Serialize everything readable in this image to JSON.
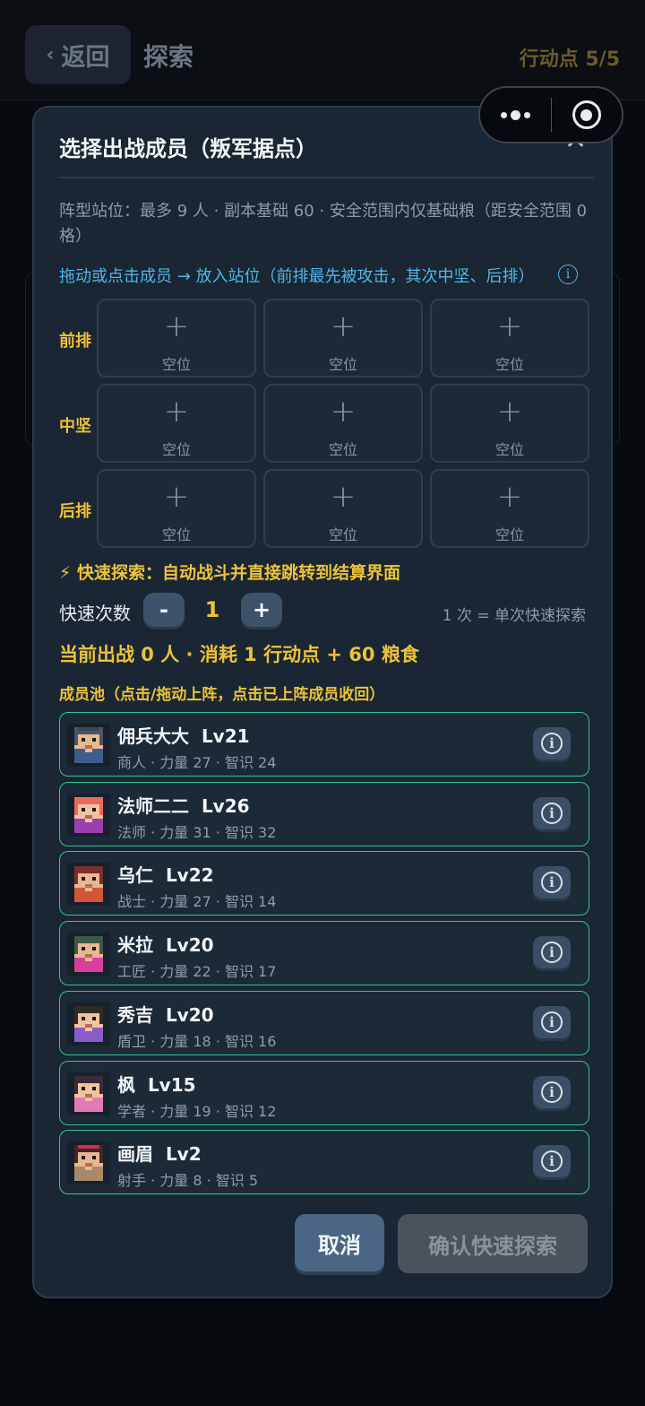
{
  "background": {
    "back_label": "返回",
    "page_title": "探索",
    "action_points": "行动点 5/5"
  },
  "modal": {
    "title": "选择出战成员（叛军据点）",
    "description": "阵型站位：最多 9 人 · 副本基础 60 · 安全范围内仅基础粮（距安全范围 0 格）",
    "hint": "拖动或点击成员 → 放入站位（前排最先被攻击，其次中坚、后排）",
    "rows": [
      {
        "label": "前排",
        "slots": [
          "空位",
          "空位",
          "空位"
        ]
      },
      {
        "label": "中坚",
        "slots": [
          "空位",
          "空位",
          "空位"
        ]
      },
      {
        "label": "后排",
        "slots": [
          "空位",
          "空位",
          "空位"
        ]
      }
    ],
    "quick_explore_title": "⚡ 快速探索：自动战斗并直接跳转到结算界面",
    "quick_count_label": "快速次数",
    "minus_label": "-",
    "plus_label": "+",
    "quick_count_value": "1",
    "quick_count_note": "1 次 = 单次快速探索",
    "cost_summary": "当前出战 0 人 · 消耗 1 行动点 + 60 粮食",
    "pool_title": "成员池（点击/拖动上阵，点击已上阵成员收回）",
    "members": [
      {
        "name": "佣兵大大",
        "level": "Lv21",
        "stats": "商人 · 力量 27 · 智识 24"
      },
      {
        "name": "法师二二",
        "level": "Lv26",
        "stats": "法师 · 力量 31 · 智识 32"
      },
      {
        "name": "乌仁",
        "level": "Lv22",
        "stats": "战士 · 力量 27 · 智识 14"
      },
      {
        "name": "米拉",
        "level": "Lv20",
        "stats": "工匠 · 力量 22 · 智识 17"
      },
      {
        "name": "秀吉",
        "level": "Lv20",
        "stats": "盾卫 · 力量 18 · 智识 16"
      },
      {
        "name": "枫",
        "level": "Lv15",
        "stats": "学者 · 力量 19 · 智识 12"
      },
      {
        "name": "画眉",
        "level": "Lv2",
        "stats": "射手 · 力量 8 · 智识 5"
      }
    ],
    "cancel_label": "取消",
    "confirm_label": "确认快速探索"
  },
  "colors": {
    "accent_gold": "#ebc23c",
    "hint_blue": "#4eb6ea",
    "member_border": "#34c48f"
  }
}
